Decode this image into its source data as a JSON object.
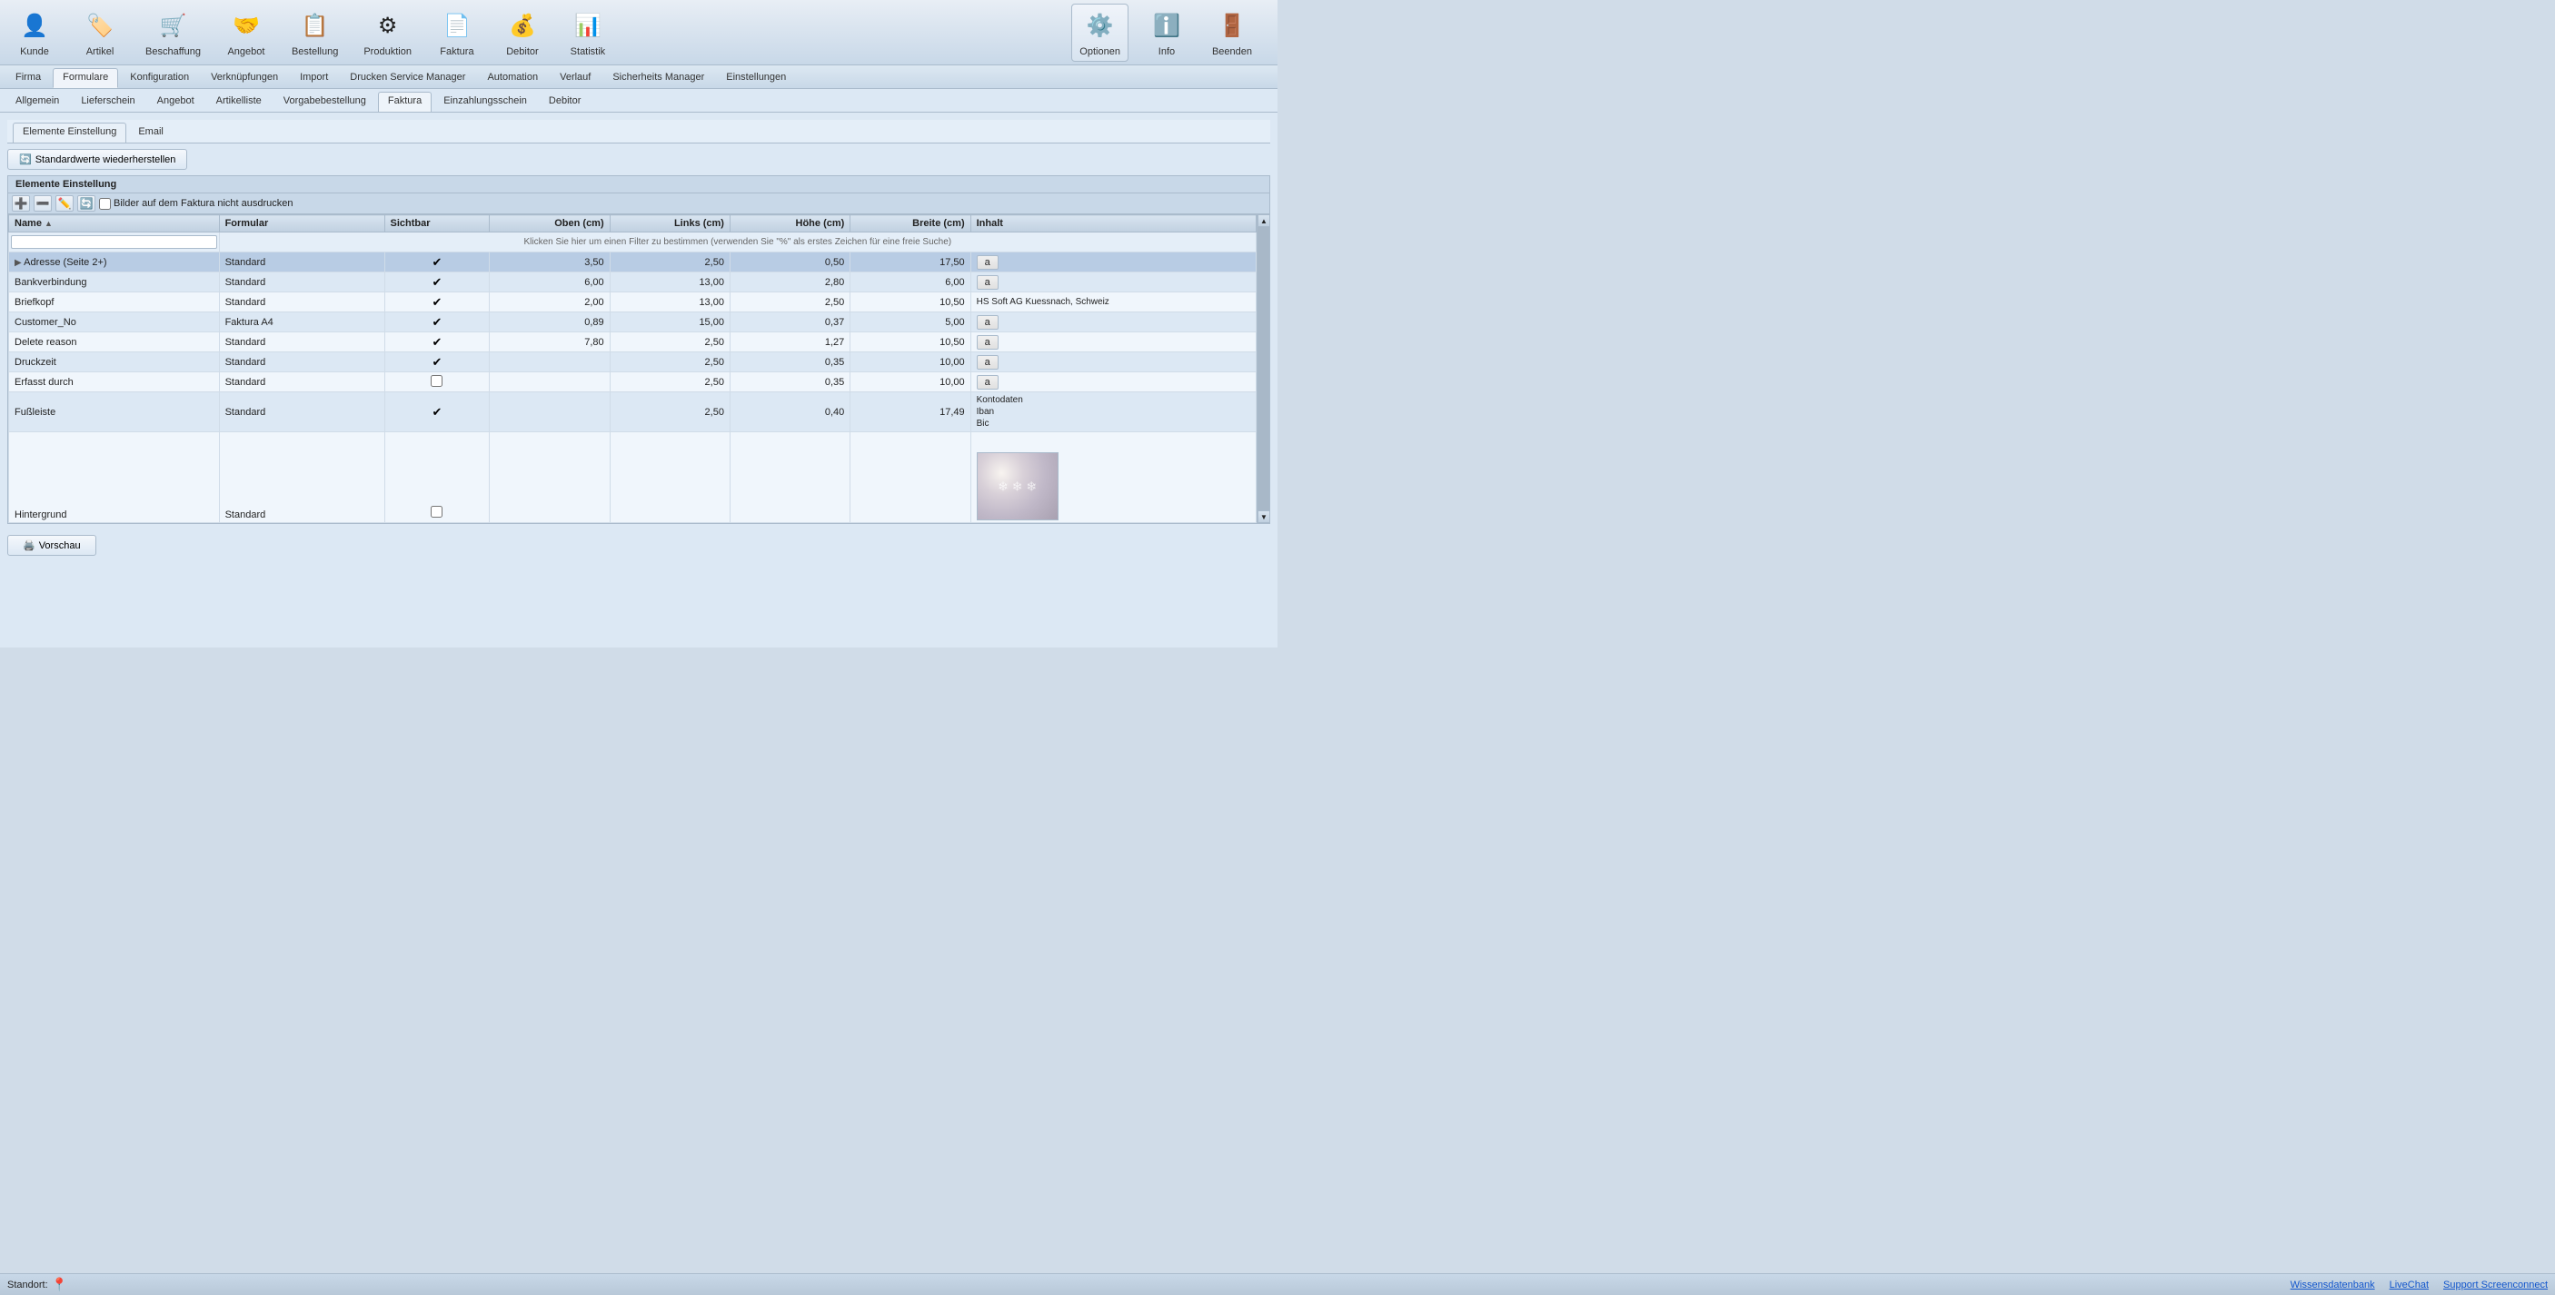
{
  "toolbar": {
    "items": [
      {
        "id": "kunde",
        "label": "Kunde",
        "icon": "👤"
      },
      {
        "id": "artikel",
        "label": "Artikel",
        "icon": "📦"
      },
      {
        "id": "beschaffung",
        "label": "Beschaffung",
        "icon": "🛒"
      },
      {
        "id": "angebot",
        "label": "Angebot",
        "icon": "🤝"
      },
      {
        "id": "bestellung",
        "label": "Bestellung",
        "icon": "📋"
      },
      {
        "id": "produktion",
        "label": "Produktion",
        "icon": "🏭"
      },
      {
        "id": "faktura",
        "label": "Faktura",
        "icon": "📄"
      },
      {
        "id": "debitor",
        "label": "Debitor",
        "icon": "💰"
      },
      {
        "id": "statistik",
        "label": "Statistik",
        "icon": "📊"
      }
    ],
    "right_items": [
      {
        "id": "optionen",
        "label": "Optionen",
        "icon": "⚙️",
        "active": true
      },
      {
        "id": "info",
        "label": "Info",
        "icon": "ℹ️"
      },
      {
        "id": "beenden",
        "label": "Beenden",
        "icon": "🚪"
      }
    ]
  },
  "top_tabs": [
    {
      "id": "firma",
      "label": "Firma"
    },
    {
      "id": "formulare",
      "label": "Formulare",
      "active": true
    },
    {
      "id": "konfiguration",
      "label": "Konfiguration"
    },
    {
      "id": "verknupfungen",
      "label": "Verknüpfungen"
    },
    {
      "id": "import",
      "label": "Import"
    },
    {
      "id": "drucken",
      "label": "Drucken Service Manager"
    },
    {
      "id": "automation",
      "label": "Automation"
    },
    {
      "id": "verlauf",
      "label": "Verlauf"
    },
    {
      "id": "sicherheits",
      "label": "Sicherheits Manager"
    },
    {
      "id": "einstellungen",
      "label": "Einstellungen"
    }
  ],
  "second_tabs": [
    {
      "id": "allgemein",
      "label": "Allgemein"
    },
    {
      "id": "lieferschein",
      "label": "Lieferschein"
    },
    {
      "id": "angebot",
      "label": "Angebot"
    },
    {
      "id": "artikelliste",
      "label": "Artikelliste"
    },
    {
      "id": "vorgabebestellung",
      "label": "Vorgabebestellung"
    },
    {
      "id": "faktura",
      "label": "Faktura",
      "active": true
    },
    {
      "id": "einzahlungsschein",
      "label": "Einzahlungsschein"
    },
    {
      "id": "debitor",
      "label": "Debitor"
    }
  ],
  "third_tabs": [
    {
      "id": "elemente",
      "label": "Elemente Einstellung",
      "active": true
    },
    {
      "id": "email",
      "label": "Email"
    }
  ],
  "restore_btn": "Standardwerte wiederherstellen",
  "section_title": "Elemente Einstellung",
  "checkbox_label": "Bilder auf dem Faktura nicht ausdrucken",
  "filter_hint": "Klicken Sie hier um einen Filter zu bestimmen (verwenden Sie \"%\" als erstes Zeichen für eine freie Suche)",
  "table": {
    "columns": [
      {
        "id": "name",
        "label": "Name",
        "sort": true
      },
      {
        "id": "formular",
        "label": "Formular"
      },
      {
        "id": "sichtbar",
        "label": "Sichtbar"
      },
      {
        "id": "oben",
        "label": "Oben (cm)",
        "align": "right"
      },
      {
        "id": "links",
        "label": "Links (cm)",
        "align": "right"
      },
      {
        "id": "hohe",
        "label": "Höhe (cm)",
        "align": "right"
      },
      {
        "id": "breite",
        "label": "Breite (cm)",
        "align": "right"
      },
      {
        "id": "inhalt",
        "label": "Inhalt"
      }
    ],
    "rows": [
      {
        "name": "Adresse (Seite 2+)",
        "formular": "Standard",
        "sichtbar": "check",
        "oben": "3,50",
        "links": "2,50",
        "hohe": "0,50",
        "breite": "17,50",
        "inhalt": "badge",
        "selected": true
      },
      {
        "name": "Bankverbindung",
        "formular": "Standard",
        "sichtbar": "check",
        "oben": "6,00",
        "links": "13,00",
        "hohe": "2,80",
        "breite": "6,00",
        "inhalt": "badge"
      },
      {
        "name": "Briefkopf",
        "formular": "Standard",
        "sichtbar": "check",
        "oben": "2,00",
        "links": "13,00",
        "hohe": "2,50",
        "breite": "10,50",
        "inhalt": "text_hs"
      },
      {
        "name": "Customer_No",
        "formular": "Faktura A4",
        "sichtbar": "check",
        "oben": "0,89",
        "links": "15,00",
        "hohe": "0,37",
        "breite": "5,00",
        "inhalt": "badge"
      },
      {
        "name": "Delete reason",
        "formular": "Standard",
        "sichtbar": "check",
        "oben": "7,80",
        "links": "2,50",
        "hohe": "1,27",
        "breite": "10,50",
        "inhalt": "badge"
      },
      {
        "name": "Druckzeit",
        "formular": "Standard",
        "sichtbar": "check",
        "oben": "",
        "links": "2,50",
        "hohe": "0,35",
        "breite": "10,00",
        "inhalt": "badge"
      },
      {
        "name": "Erfasst durch",
        "formular": "Standard",
        "sichtbar": "empty",
        "oben": "",
        "links": "2,50",
        "hohe": "0,35",
        "breite": "10,00",
        "inhalt": "badge"
      },
      {
        "name": "Fußleiste",
        "formular": "Standard",
        "sichtbar": "check",
        "oben": "",
        "links": "2,50",
        "hohe": "0,40",
        "breite": "17,49",
        "inhalt": "text_kontodaten"
      },
      {
        "name": "Hintergrund",
        "formular": "Standard",
        "sichtbar": "empty",
        "oben": "",
        "links": "",
        "hohe": "",
        "breite": "",
        "inhalt": "image"
      }
    ]
  },
  "inhalt_texts": {
    "hs_soft": "HS Soft AG Kuessnach, Schweiz",
    "kontodaten": "Kontodaten\nIban\nBic"
  },
  "preview_btn": "Vorschau",
  "status": {
    "standort_label": "Standort:",
    "links": [
      {
        "id": "wissensdatenbank",
        "label": "Wissensdatenbank"
      },
      {
        "id": "livechat",
        "label": "LiveChat"
      },
      {
        "id": "support",
        "label": "Support Screenconnect"
      }
    ]
  }
}
